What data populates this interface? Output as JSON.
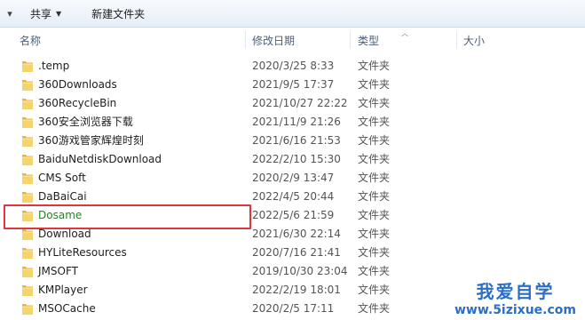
{
  "toolbar": {
    "share_label": "共享",
    "new_folder_label": "新建文件夹"
  },
  "header": {
    "name": "名称",
    "date": "修改日期",
    "type": "类型",
    "size": "大小"
  },
  "files": [
    {
      "name": ".temp",
      "date": "2020/3/25 8:33",
      "type": "文件夹"
    },
    {
      "name": "360Downloads",
      "date": "2021/9/5 17:37",
      "type": "文件夹"
    },
    {
      "name": "360RecycleBin",
      "date": "2021/10/27 22:22",
      "type": "文件夹"
    },
    {
      "name": "360安全浏览器下载",
      "date": "2021/11/9 21:26",
      "type": "文件夹"
    },
    {
      "name": "360游戏管家辉煌时刻",
      "date": "2021/6/16 21:53",
      "type": "文件夹"
    },
    {
      "name": "BaiduNetdiskDownload",
      "date": "2022/2/10 15:30",
      "type": "文件夹"
    },
    {
      "name": "CMS Soft",
      "date": "2020/2/9 13:47",
      "type": "文件夹"
    },
    {
      "name": "DaBaiCai",
      "date": "2022/4/5 20:44",
      "type": "文件夹"
    },
    {
      "name": "Dosame",
      "date": "2022/5/6 21:59",
      "type": "文件夹",
      "highlighted": true
    },
    {
      "name": "Download",
      "date": "2021/6/30 22:14",
      "type": "文件夹"
    },
    {
      "name": "HYLiteResources",
      "date": "2020/7/16 21:41",
      "type": "文件夹"
    },
    {
      "name": "JMSOFT",
      "date": "2019/10/30 23:04",
      "type": "文件夹"
    },
    {
      "name": "KMPlayer",
      "date": "2022/2/19 18:01",
      "type": "文件夹"
    },
    {
      "name": "MSOCache",
      "date": "2020/2/5 17:11",
      "type": "文件夹"
    }
  ],
  "watermark": {
    "title": "我爱自学",
    "url": "www.5izixue.com"
  },
  "colors": {
    "highlight_border": "#e0353c",
    "highlight_text": "#1a8a1a",
    "folder_yellow": "#f3cf63"
  }
}
